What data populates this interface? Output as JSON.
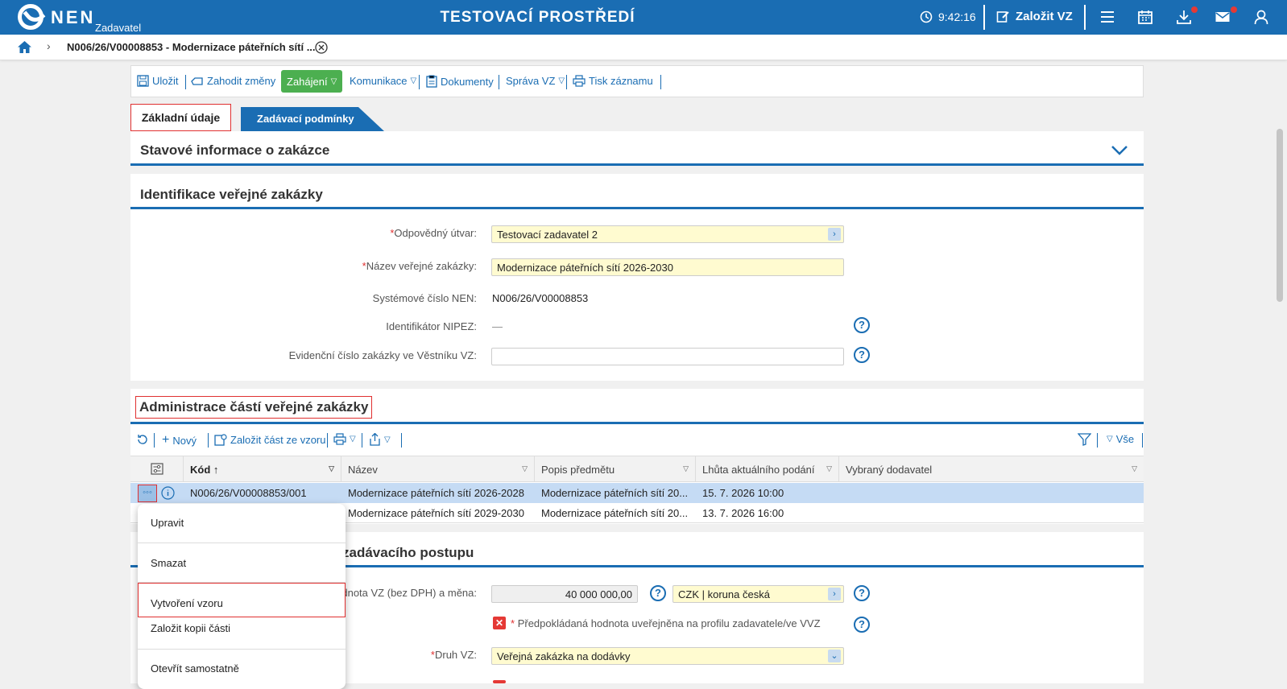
{
  "header": {
    "logo_text": "NEN",
    "logo_sub": "Zadavatel",
    "env_title": "TESTOVACÍ PROSTŘEDÍ",
    "time": "9:42:16",
    "create_label": "Založit VZ"
  },
  "breadcrumb": {
    "title": "N006/26/V00008853 - Modernizace páteřních sítí ..."
  },
  "toolbar": {
    "save": "Uložit",
    "discard": "Zahodit změny",
    "start": "Zahájení",
    "communication": "Komunikace",
    "documents": "Dokumenty",
    "admin": "Správa VZ",
    "print": "Tisk záznamu"
  },
  "tabs": {
    "basic": "Základní údaje",
    "conditions": "Zadávací podmínky"
  },
  "status_panel": {
    "title": "Stavové informace o zakázce"
  },
  "identification": {
    "title": "Identifikace veřejné zakázky",
    "unit_label": "Odpovědný útvar:",
    "unit_value": "Testovací zadavatel 2",
    "name_label": "Název veřejné zakázky:",
    "name_value": "Modernizace páteřních sítí 2026-2030",
    "sysnum_label": "Systémové číslo NEN:",
    "sysnum_value": "N006/26/V00008853",
    "nipez_label": "Identifikátor NIPEZ:",
    "nipez_value": "—",
    "journal_label": "Evidenční číslo zakázky ve Věstníku VZ:",
    "journal_value": ""
  },
  "parts": {
    "title": "Administrace částí veřejné zakázky",
    "new": "Nový",
    "from_template": "Založit část ze vzoru",
    "all": "Vše",
    "columns": {
      "code": "Kód",
      "name": "Název",
      "desc": "Popis předmětu",
      "deadline": "Lhůta aktuálního podání",
      "supplier": "Vybraný dodavatel"
    },
    "rows": [
      {
        "code": "N006/26/V00008853/001",
        "name": "Modernizace páteřních sítí 2026-2028",
        "desc": "Modernizace páteřních sítí 20...",
        "deadline": "15. 7. 2026 10:00",
        "supplier": ""
      },
      {
        "code": "",
        "name": "Modernizace páteřních sítí 2029-2030",
        "desc": "Modernizace páteřních sítí 20...",
        "deadline": "13. 7. 2026 16:00",
        "supplier": ""
      }
    ]
  },
  "procedure": {
    "title_partial": "zadávacího postupu",
    "value_label": "hodnota VZ (bez DPH) a měna:",
    "value_amount": "40 000 000,00",
    "currency": "CZK | koruna česká",
    "published_label": "Předpokládaná hodnota uveřejněna na profilu zadavatele/ve VVZ",
    "type_label": "Druh VZ:",
    "type_value": "Veřejná zakázka na dodávky"
  },
  "context_menu": {
    "edit": "Upravit",
    "delete": "Smazat",
    "create_template": "Vytvoření vzoru",
    "copy_part": "Založit kopii části",
    "open_separately": "Otevřít samostatně"
  }
}
